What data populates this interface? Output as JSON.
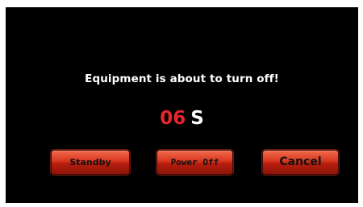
{
  "dialog": {
    "message": "Equipment is about to turn off!",
    "countdown_value": "06",
    "countdown_unit": "S"
  },
  "buttons": {
    "standby_label": "Standby",
    "power_off_label": "Power Off",
    "cancel_label": "Cancel"
  },
  "colors": {
    "background": "#000000",
    "countdown": "#e8262b",
    "button": "#d8361f"
  }
}
